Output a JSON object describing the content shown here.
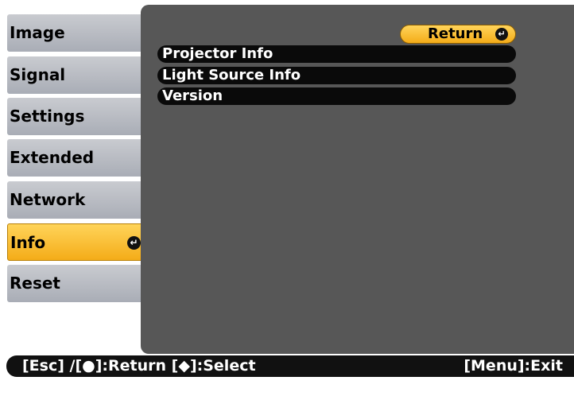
{
  "sidebar": {
    "items": [
      {
        "label": "Image"
      },
      {
        "label": "Signal"
      },
      {
        "label": "Settings"
      },
      {
        "label": "Extended"
      },
      {
        "label": "Network"
      },
      {
        "label": "Info",
        "active": true
      },
      {
        "label": "Reset"
      }
    ]
  },
  "panel": {
    "return_label": "Return",
    "items": [
      {
        "label": "Projector Info"
      },
      {
        "label": "Light Source Info"
      },
      {
        "label": "Version"
      }
    ]
  },
  "status_bar": {
    "left_text": "[Esc] /[●]:Return  [◆]:Select",
    "right_text": "[Menu]:Exit"
  },
  "icons": {
    "enter_icon": "↵"
  },
  "colors": {
    "active_tab": "#f4ac18",
    "panel_bg": "#575757",
    "item_bg": "#0a0a0a"
  }
}
